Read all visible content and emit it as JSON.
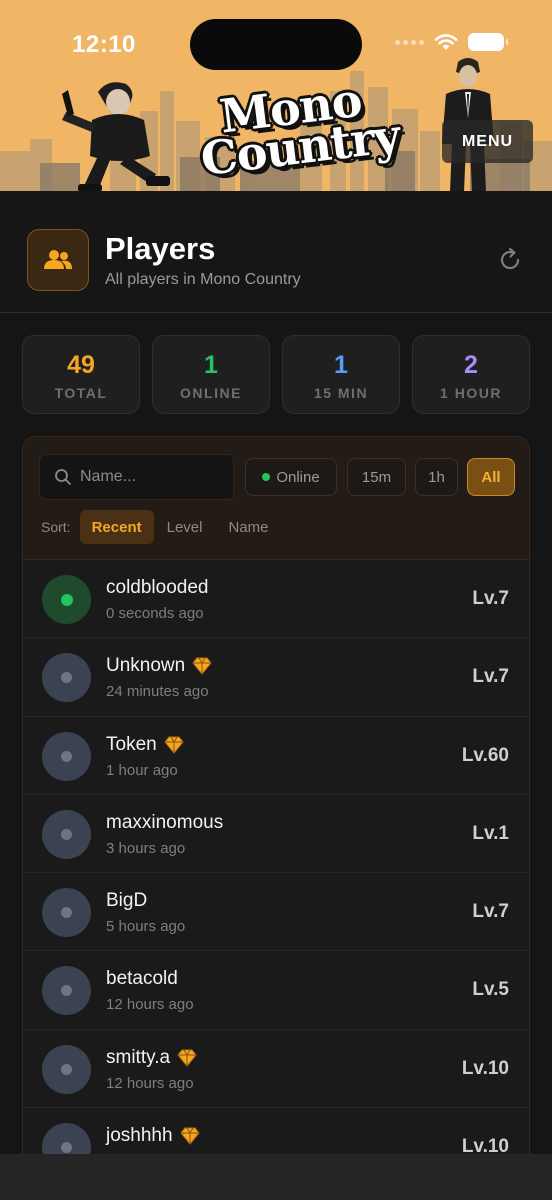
{
  "status_bar": {
    "time": "12:10"
  },
  "banner": {
    "logo_line1": "Mono",
    "logo_line2": "Country",
    "menu_label": "MENU"
  },
  "header": {
    "title": "Players",
    "subtitle": "All players in Mono Country"
  },
  "stats": [
    {
      "value": "49",
      "label": "TOTAL",
      "color": "#f5a623"
    },
    {
      "value": "1",
      "label": "ONLINE",
      "color": "#22c55e"
    },
    {
      "value": "1",
      "label": "15 MIN",
      "color": "#5b9cf5"
    },
    {
      "value": "2",
      "label": "1 HOUR",
      "color": "#a78bfa"
    }
  ],
  "filters": {
    "search_placeholder": "Name...",
    "online": "Online",
    "m15": "15m",
    "h1": "1h",
    "all": "All",
    "selected": "All"
  },
  "sort": {
    "label": "Sort:",
    "options": [
      "Recent",
      "Level",
      "Name"
    ],
    "selected": "Recent"
  },
  "players": [
    {
      "name": "coldblooded",
      "time": "0 seconds ago",
      "level": "Lv.7",
      "online": true,
      "premium": false
    },
    {
      "name": "Unknown",
      "time": "24 minutes ago",
      "level": "Lv.7",
      "online": false,
      "premium": true
    },
    {
      "name": "Token",
      "time": "1 hour ago",
      "level": "Lv.60",
      "online": false,
      "premium": true
    },
    {
      "name": "maxxinomous",
      "time": "3 hours ago",
      "level": "Lv.1",
      "online": false,
      "premium": false
    },
    {
      "name": "BigD",
      "time": "5 hours ago",
      "level": "Lv.7",
      "online": false,
      "premium": false
    },
    {
      "name": "betacold",
      "time": "12 hours ago",
      "level": "Lv.5",
      "online": false,
      "premium": false
    },
    {
      "name": "smitty.a",
      "time": "12 hours ago",
      "level": "Lv.10",
      "online": false,
      "premium": true
    },
    {
      "name": "joshhhh",
      "time": "",
      "level": "Lv.10",
      "online": false,
      "premium": true
    }
  ],
  "icons": {
    "players": "users-icon",
    "refresh": "refresh-icon",
    "search": "search-icon",
    "premium": "diamond-icon"
  }
}
